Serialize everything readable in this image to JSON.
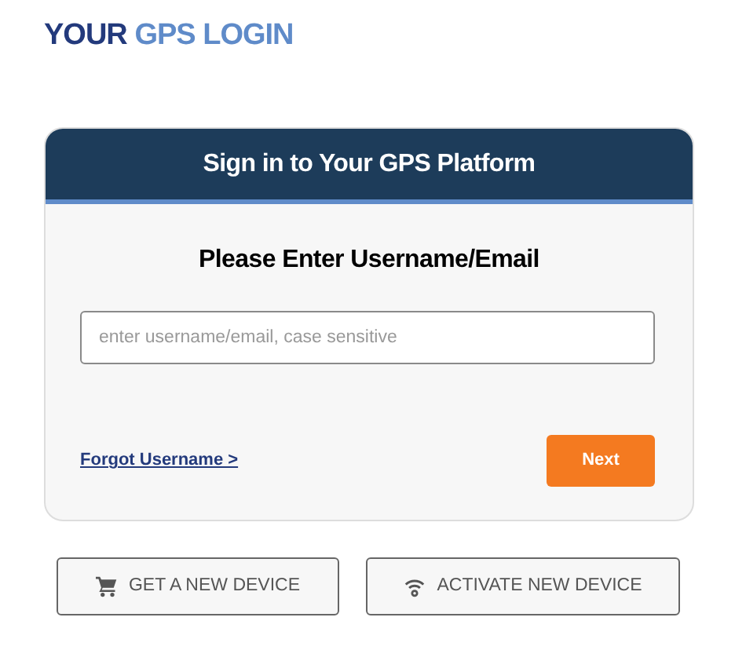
{
  "page_title": {
    "lead": "YOUR",
    "rest": "GPS LOGIN"
  },
  "card": {
    "header": "Sign in to Your GPS Platform",
    "heading": "Please Enter Username/Email",
    "field": {
      "placeholder": "enter username/email, case sensitive"
    },
    "link": "Forgot Username >",
    "button": "Next"
  },
  "actions": [
    {
      "kind": "cart",
      "label": "GET A NEW DEVICE"
    },
    {
      "kind": "signal",
      "label": "ACTIVATE NEW DEVICE"
    }
  ]
}
